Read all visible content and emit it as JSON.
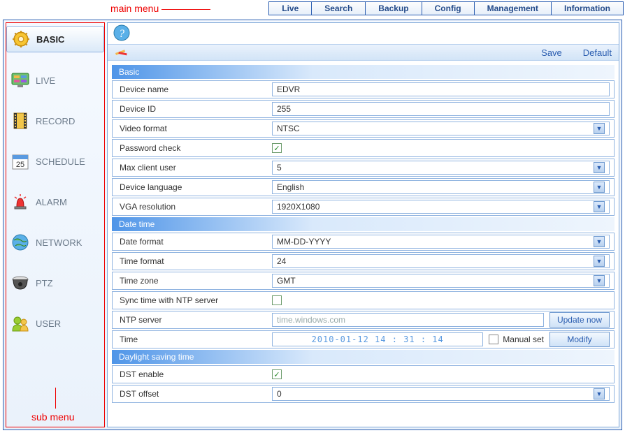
{
  "annotations": {
    "main_menu": "main menu",
    "sub_menu": "sub menu"
  },
  "mainMenu": [
    "Live",
    "Search",
    "Backup",
    "Config",
    "Management",
    "Information"
  ],
  "sidebar": {
    "items": [
      {
        "label": "BASIC",
        "icon": "gear-icon"
      },
      {
        "label": "LIVE",
        "icon": "monitor-icon"
      },
      {
        "label": "RECORD",
        "icon": "film-icon"
      },
      {
        "label": "SCHEDULE",
        "icon": "calendar-icon"
      },
      {
        "label": "ALARM",
        "icon": "alarm-icon"
      },
      {
        "label": "NETWORK",
        "icon": "globe-icon"
      },
      {
        "label": "PTZ",
        "icon": "dome-icon"
      },
      {
        "label": "USER",
        "icon": "user-icon"
      }
    ],
    "activeIndex": 0
  },
  "toolbar": {
    "save": "Save",
    "default": "Default"
  },
  "basic": {
    "section": "Basic",
    "deviceName": {
      "label": "Device name",
      "value": "EDVR"
    },
    "deviceId": {
      "label": "Device ID",
      "value": "255"
    },
    "videoFormat": {
      "label": "Video format",
      "value": "NTSC"
    },
    "passwordCheck": {
      "label": "Password check",
      "checked": true
    },
    "maxClientUser": {
      "label": "Max client user",
      "value": "5"
    },
    "deviceLanguage": {
      "label": "Device language",
      "value": "English"
    },
    "vgaResolution": {
      "label": "VGA resolution",
      "value": "1920X1080"
    }
  },
  "datetime": {
    "section": "Date time",
    "dateFormat": {
      "label": "Date format",
      "value": "MM-DD-YYYY"
    },
    "timeFormat": {
      "label": "Time format",
      "value": "24"
    },
    "timeZone": {
      "label": "Time zone",
      "value": "GMT"
    },
    "syncNtp": {
      "label": "Sync time with NTP server",
      "checked": false
    },
    "ntpServer": {
      "label": "NTP server",
      "value": "time.windows.com",
      "button": "Update now"
    },
    "time": {
      "label": "Time",
      "value": "2010-01-12   14 : 31 : 14",
      "manual": "Manual set",
      "manualChecked": false,
      "button": "Modify"
    }
  },
  "dst": {
    "section": "Daylight saving time",
    "enable": {
      "label": "DST enable",
      "checked": true
    },
    "offset": {
      "label": "DST offset",
      "value": "0"
    }
  }
}
